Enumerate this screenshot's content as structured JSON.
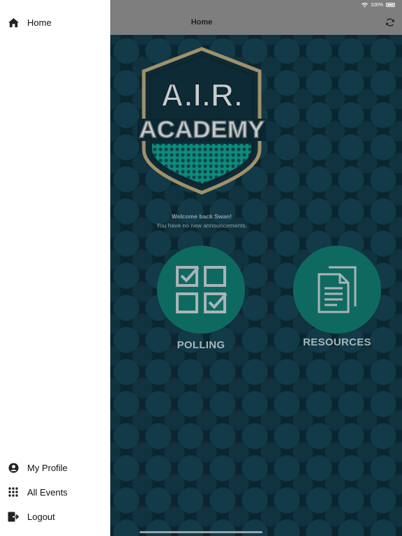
{
  "status_bar": {
    "battery_text": "100%"
  },
  "navbar": {
    "title": "Home"
  },
  "welcome": {
    "greeting": "Welcome back Swan!",
    "announcement": "You have no new announcements."
  },
  "logo": {
    "line1": "A.I.R.",
    "line2": "ACADEMY"
  },
  "tiles": [
    {
      "label": "POLLING",
      "icon": "checklist-grid-icon"
    },
    {
      "label": "RESOURCES",
      "icon": "documents-icon"
    }
  ],
  "drawer": {
    "top_items": [
      {
        "label": "Home",
        "icon": "home-icon"
      }
    ],
    "bottom_items": [
      {
        "label": "My Profile",
        "icon": "user-circle-icon"
      },
      {
        "label": "All Events",
        "icon": "grid-dots-icon"
      },
      {
        "label": "Logout",
        "icon": "logout-icon"
      }
    ]
  },
  "colors": {
    "background": "#0b2630",
    "accent_teal": "#0e6a61",
    "logo_gold": "#a0916a",
    "navbar": "#7e7e7e"
  }
}
